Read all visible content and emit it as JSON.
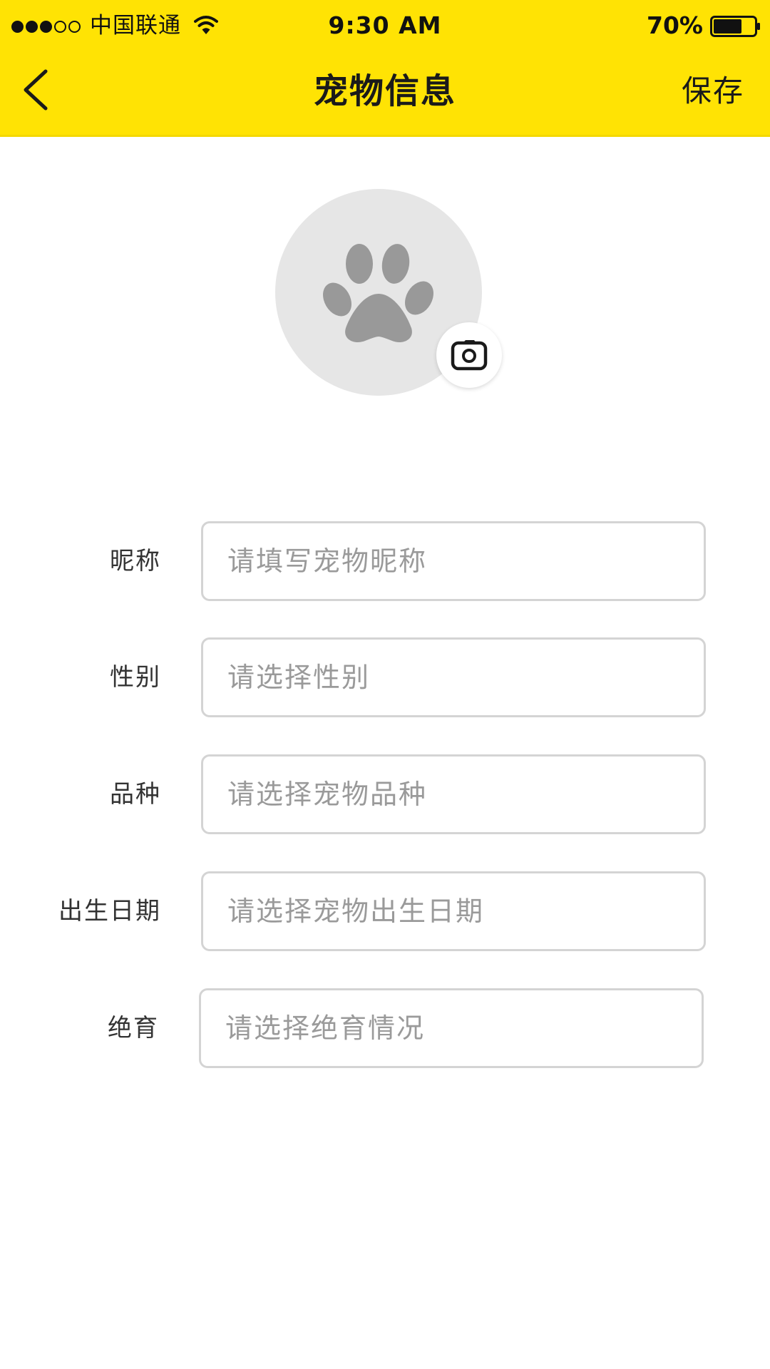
{
  "status_bar": {
    "carrier": "中国联通",
    "time": "9:30 AM",
    "battery_percent": "70%",
    "battery_level": 0.7,
    "signal_strength": 3,
    "signal_max": 5
  },
  "nav": {
    "title": "宠物信息",
    "save_label": "保存"
  },
  "avatar": {
    "placeholder_icon": "paw-icon",
    "camera_icon": "camera-icon"
  },
  "form": {
    "nickname": {
      "label": "昵称",
      "placeholder": "请填写宠物昵称",
      "value": ""
    },
    "gender": {
      "label": "性别",
      "placeholder": "请选择性别",
      "value": ""
    },
    "breed": {
      "label": "品种",
      "placeholder": "请选择宠物品种",
      "value": ""
    },
    "birthday": {
      "label": "出生日期",
      "placeholder": "请选择宠物出生日期",
      "value": ""
    },
    "neutered": {
      "label": "绝育",
      "placeholder": "请选择绝育情况",
      "value": ""
    }
  },
  "colors": {
    "header_bg": "#FFE304",
    "input_border": "#D4D4D4",
    "placeholder": "#9A9A9A",
    "avatar_bg": "#E6E6E6",
    "paw": "#999999"
  }
}
